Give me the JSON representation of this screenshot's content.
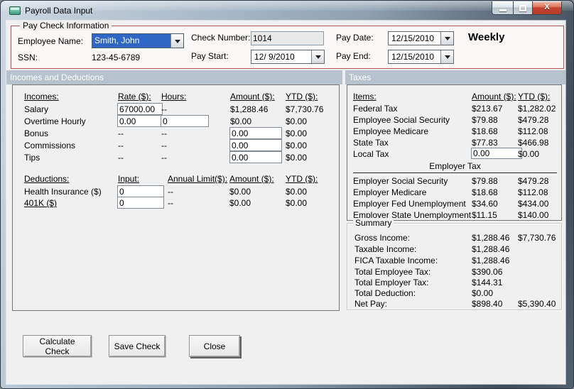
{
  "titlebar": {
    "title": "Payroll Data Input"
  },
  "paycheck": {
    "group_label": "Pay Check Information",
    "employee_name_label": "Employee Name:",
    "employee_name": "Smith, John",
    "ssn_label": "SSN:",
    "ssn": "123-45-6789",
    "check_number_label": "Check Number:",
    "check_number": "1014",
    "pay_start_label": "Pay Start:",
    "pay_start": "12/ 9/2010",
    "pay_date_label": "Pay Date:",
    "pay_date": "12/15/2010",
    "pay_end_label": "Pay End:",
    "pay_end": "12/15/2010",
    "frequency": "Weekly"
  },
  "sections": {
    "incomes_header": "Incomes and Deductions",
    "taxes_header": "Taxes"
  },
  "incomes": {
    "headers": {
      "item": "Incomes:",
      "rate": "Rate ($):",
      "hours": "Hours:",
      "amount": "Amount ($):",
      "ytd": "YTD ($):"
    },
    "rows": [
      {
        "label": "Salary",
        "rate": "67000.00",
        "hours": "--",
        "amount": "$1,288.46",
        "ytd": "$7,730.76"
      },
      {
        "label": "Overtime Hourly",
        "rate": "0.00",
        "hours": "0",
        "amount": "$0.00",
        "ytd": "$0.00"
      },
      {
        "label": "Bonus",
        "rate": "--",
        "hours": "--",
        "amount": "0.00",
        "ytd": "$0.00"
      },
      {
        "label": "Commissions",
        "rate": "--",
        "hours": "--",
        "amount": "0.00",
        "ytd": "$0.00"
      },
      {
        "label": "Tips",
        "rate": "--",
        "hours": "--",
        "amount": "0.00",
        "ytd": "$0.00"
      }
    ]
  },
  "deductions": {
    "headers": {
      "item": "Deductions:",
      "input": "Input:",
      "limit": "Annual Limit($):",
      "amount": "Amount ($):",
      "ytd": "YTD ($):"
    },
    "rows": [
      {
        "label": "Health Insurance ($)",
        "input": "0",
        "limit": "--",
        "amount": "$0.00",
        "ytd": "$0.00"
      },
      {
        "label": "401K ($)",
        "input": "0",
        "limit": "--",
        "amount": "$0.00",
        "ytd": "$0.00"
      }
    ]
  },
  "taxes": {
    "headers": {
      "item": "Items:",
      "amount": "Amount ($):",
      "ytd": "YTD ($):"
    },
    "employee_rows": [
      {
        "label": "Federal Tax",
        "amount": "$213.67",
        "ytd": "$1,282.02"
      },
      {
        "label": "Employee Social Security",
        "amount": "$79.88",
        "ytd": "$479.28"
      },
      {
        "label": "Employee Medicare",
        "amount": "$18.68",
        "ytd": "$112.08"
      },
      {
        "label": "State Tax",
        "amount": "$77.83",
        "ytd": "$466.98"
      },
      {
        "label": "Local Tax",
        "amount": "0.00",
        "ytd": "$0.00"
      }
    ],
    "employer_header": "Employer Tax",
    "employer_rows": [
      {
        "label": "Employer Social Security",
        "amount": "$79.88",
        "ytd": "$479.28"
      },
      {
        "label": "Employer Medicare",
        "amount": "$18.68",
        "ytd": "$112.08"
      },
      {
        "label": "Employer Fed Unemployment",
        "amount": "$34.60",
        "ytd": "$434.00"
      },
      {
        "label": "Employer State Unemployment",
        "amount": "$11.15",
        "ytd": "$140.00"
      }
    ]
  },
  "summary": {
    "group_label": "Summary",
    "rows": [
      {
        "label": "Gross Income:",
        "amount": "$1,288.46",
        "ytd": "$7,730.76"
      },
      {
        "label": "Taxable Income:",
        "amount": "$1,288.46",
        "ytd": ""
      },
      {
        "label": "FICA Taxable Income:",
        "amount": "$1,288.46",
        "ytd": ""
      },
      {
        "label": "Total Employee Tax:",
        "amount": "$390.06",
        "ytd": ""
      },
      {
        "label": "Total Employer Tax:",
        "amount": "$144.31",
        "ytd": ""
      },
      {
        "label": "Total Deduction:",
        "amount": "$0.00",
        "ytd": ""
      },
      {
        "label": "Net Pay:",
        "amount": "$898.40",
        "ytd": "$5,390.40"
      }
    ]
  },
  "buttons": {
    "calculate": "Calculate Check",
    "save": "Save Check",
    "close": "Close"
  },
  "colors": {
    "section_header_bg": "#b6c2cd",
    "group_border_red": "#b05454",
    "selection_blue": "#2e66c6",
    "close_button_red": "#c44231",
    "content_bg": "#f0f0f0"
  }
}
